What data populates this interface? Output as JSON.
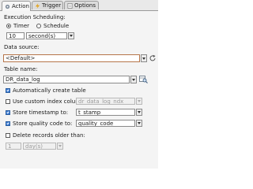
{
  "tabs": [
    {
      "label": "Action",
      "active": true,
      "icon": "action-gear-icon"
    },
    {
      "label": "Trigger",
      "active": false,
      "icon": "trigger-lightning-icon"
    },
    {
      "label": "Options",
      "active": false,
      "icon": "options-page-icon"
    }
  ],
  "execution": {
    "title": "Execution Scheduling:",
    "timer_label": "Timer",
    "schedule_label": "Schedule",
    "selected": "Timer",
    "interval_value": "10",
    "interval_unit": "second(s)"
  },
  "data_source": {
    "label": "Data source:",
    "value": "<Default>",
    "highlight_color": "#b5754a"
  },
  "table_name": {
    "label": "Table name:",
    "value": "DR_data_log"
  },
  "options": {
    "auto_create_label": "Automatically create table",
    "auto_create_checked": true,
    "custom_index_label": "Use custom index column:",
    "custom_index_checked": false,
    "custom_index_value": "dr_data_log_ndx",
    "timestamp_label": "Store timestamp to:",
    "timestamp_checked": true,
    "timestamp_value": "t_stamp",
    "quality_label": "Store quality code to:",
    "quality_checked": true,
    "quality_value": "quality_code",
    "delete_label": "Delete records older than:",
    "delete_checked": false,
    "delete_value": "1",
    "delete_unit": "day(s)"
  },
  "colors": {
    "accent": "#3a7bd5"
  }
}
